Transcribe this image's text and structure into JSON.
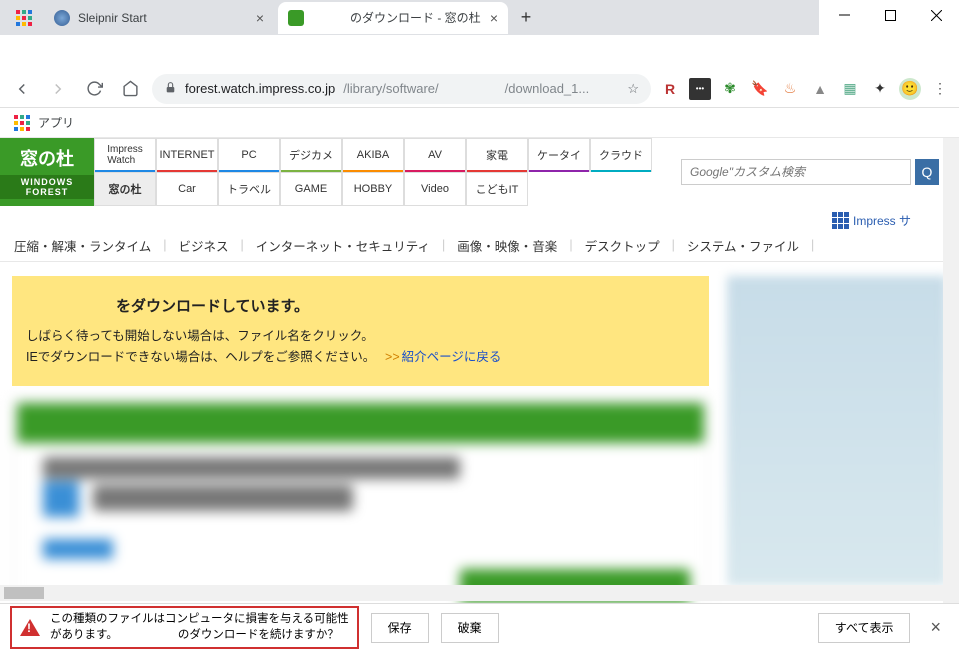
{
  "window": {
    "tabs": [
      {
        "title": "Sleipnir Start"
      },
      {
        "title": "のダウンロード - 窓の杜"
      }
    ]
  },
  "omnibox": {
    "host": "forest.watch.impress.co.jp",
    "path1": "/library/software/",
    "path2": "/download_1..."
  },
  "bookmarks_label": "アプリ",
  "site": {
    "logo_main": "窓の杜",
    "logo_sub": "WINDOWS FOREST",
    "nav_top": [
      "Impress Watch",
      "INTERNET",
      "PC",
      "デジカメ",
      "AKIBA",
      "AV",
      "家電",
      "ケータイ",
      "クラウド"
    ],
    "nav_bottom": [
      "窓の杜",
      "Car",
      "トラベル",
      "GAME",
      "HOBBY",
      "Video",
      "こどもIT"
    ],
    "search_placeholder": "Google\"カスタム検索",
    "impress_link": "Impress サ"
  },
  "subnav": [
    "圧縮・解凍・ランタイム",
    "ビジネス",
    "インターネット・セキュリティ",
    "画像・映像・音楽",
    "デスクトップ",
    "システム・ファイル"
  ],
  "notice": {
    "headline_suffix": "をダウンロードしています。",
    "line2": "しばらく待っても開始しない場合は、ファイル名をクリック。",
    "line3_pre": "IEでダウンロードできない場合は、ヘルプをご参照ください。　",
    "arrows": ">>",
    "link": "紹介ページに戻る"
  },
  "download_bar": {
    "warn_line1": "この種類のファイルはコンピュータに損害を与える可能性",
    "warn_line2_pre": "があります。",
    "warn_line2_post": "のダウンロードを続けますか？",
    "keep": "保存",
    "discard": "破棄",
    "show_all": "すべて表示"
  }
}
